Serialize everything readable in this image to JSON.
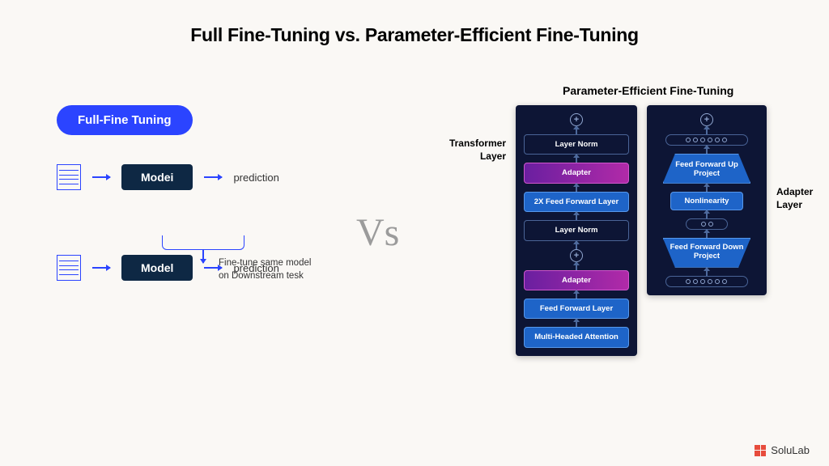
{
  "title": "Full Fine-Tuning vs. Parameter-Efficient Fine-Tuning",
  "left": {
    "pill": "Full-Fine Tuning",
    "model1": "Modei",
    "model2": "Model",
    "pred": "prediction",
    "ft_line1": "Fine-tune same model",
    "ft_line2": "on Downstream tesk"
  },
  "vs": "Vs",
  "right": {
    "title": "Parameter-Efficient Fine-Tuning",
    "transformer_label": "Transformer Layer",
    "adapter_label": "Adapter Layer",
    "transformer": {
      "ln1": "Layer Norm",
      "adapter1": "Adapter",
      "ff2x": "2X Feed Forward Layer",
      "ln2": "Layer Norm",
      "adapter2": "Adapter",
      "ff": "Feed Forward Layer",
      "mha": "Multi-Headed Attention"
    },
    "adapter": {
      "up": "Feed Forward Up Project",
      "nonlin": "Nonlinearity",
      "down": "Feed Forward Down Project"
    }
  },
  "footer": {
    "brand": "SoluLab"
  }
}
